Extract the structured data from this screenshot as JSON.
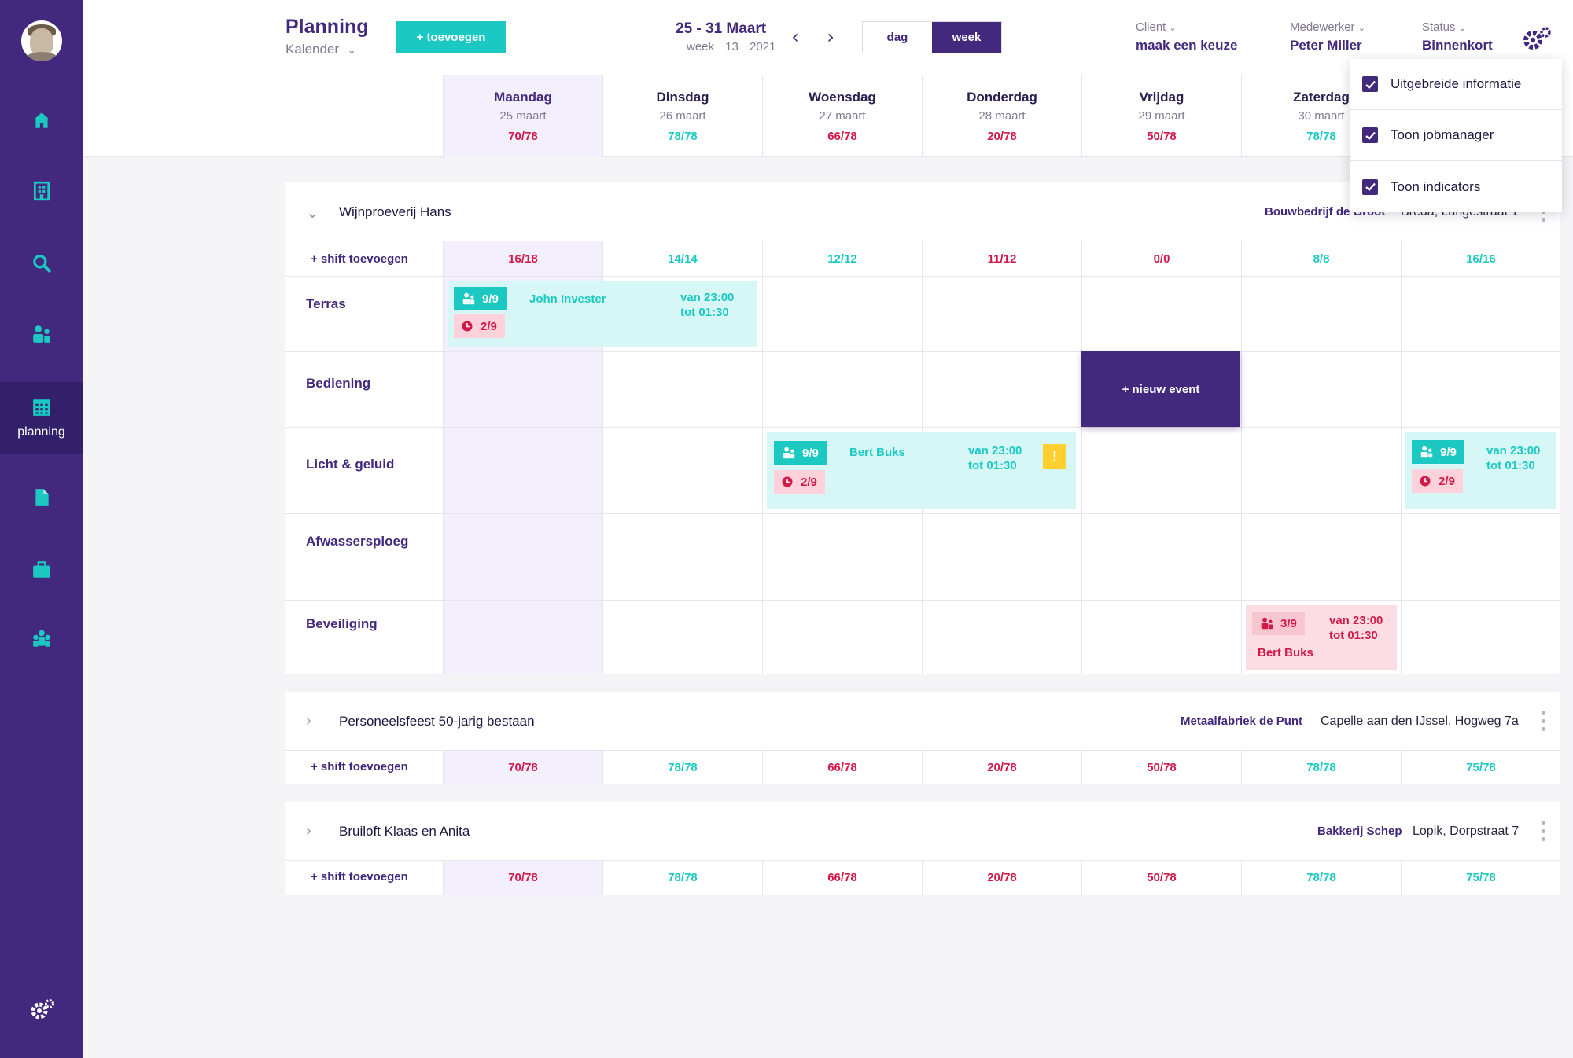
{
  "sidebar": {
    "active_label": "planning",
    "icons": [
      "home-icon",
      "building-icon",
      "search-icon",
      "people-icon",
      "calendar-icon",
      "document-icon",
      "briefcase-icon",
      "team-icon"
    ],
    "settings_icon": "gear-icon"
  },
  "header": {
    "title": "Planning",
    "view": "Kalender",
    "add_button": "+ toevoegen",
    "date_range": "25 - 31  Maart",
    "week": "week 13",
    "year": "2021",
    "toggle": {
      "day": "dag",
      "week": "week",
      "selected": "week"
    },
    "filters": [
      {
        "label": "Client",
        "value": "maak een keuze"
      },
      {
        "label": "Medewerker",
        "value": "Peter Miller"
      },
      {
        "label": "Status",
        "value": "Binnenkort"
      }
    ]
  },
  "days": [
    {
      "name": "Maandag",
      "date": "25 maart",
      "count": "70/78",
      "status": "red"
    },
    {
      "name": "Dinsdag",
      "date": "26 maart",
      "count": "78/78",
      "status": "teal"
    },
    {
      "name": "Woensdag",
      "date": "27 maart",
      "count": "66/78",
      "status": "red"
    },
    {
      "name": "Donderdag",
      "date": "28 maart",
      "count": "20/78",
      "status": "red"
    },
    {
      "name": "Vrijdag",
      "date": "29 maart",
      "count": "50/78",
      "status": "red"
    },
    {
      "name": "Zaterdag",
      "date": "30 maart",
      "count": "78/78",
      "status": "teal"
    }
  ],
  "dropdown": {
    "items": [
      {
        "label": "Uitgebreide informatie",
        "checked": true
      },
      {
        "label": "Toon jobmanager",
        "checked": true
      },
      {
        "label": "Toon indicators",
        "checked": true
      }
    ]
  },
  "events": [
    {
      "title": "Wijnproeverij Hans",
      "client": "Bouwbedrijf de Groot",
      "address": "Breda, Langestraat 1",
      "expanded": true,
      "shift_add": "+ shift toevoegen",
      "counts": [
        "16/18",
        "14/14",
        "12/12",
        "11/12",
        "0/0",
        "8/8",
        "16/16"
      ],
      "count_status": [
        "red",
        "teal",
        "teal",
        "red",
        "red",
        "teal",
        "teal"
      ],
      "rows": [
        "Terras",
        "Bediening",
        "Licht & geluid",
        "Afwassersploeg",
        "Beveiliging"
      ],
      "shifts": {
        "terras": {
          "count": "9/9",
          "late": "2/9",
          "person": "John Invester",
          "time_from": "van 23:00",
          "time_to": "tot 01:30"
        },
        "licht_wed": {
          "count": "9/9",
          "late": "2/9",
          "person": "Bert Buks",
          "time_from": "van 23:00",
          "time_to": "tot 01:30",
          "warning": "!"
        },
        "licht_sun": {
          "count": "9/9",
          "late": "2/9",
          "time_from": "van 23:00",
          "time_to": "tot 01:30"
        },
        "beveiliging": {
          "count": "3/9",
          "person": "Bert Buks",
          "time_from": "van 23:00",
          "time_to": "tot 01:30"
        }
      },
      "new_event": "+ nieuw event"
    },
    {
      "title": "Personeelsfeest 50-jarig bestaan",
      "client": "Metaalfabriek de Punt",
      "address": "Capelle aan den IJssel, Hogweg 7a",
      "expanded": false,
      "shift_add": "+ shift toevoegen",
      "counts": [
        "70/78",
        "78/78",
        "66/78",
        "20/78",
        "50/78",
        "78/78",
        "75/78"
      ],
      "count_status": [
        "red",
        "teal",
        "red",
        "red",
        "red",
        "teal",
        "teal"
      ]
    },
    {
      "title": "Bruiloft Klaas en Anita",
      "client": "Bakkerij Schep",
      "address": "Lopik, Dorpstraat 7",
      "expanded": false,
      "shift_add": "+ shift toevoegen",
      "counts": [
        "70/78",
        "78/78",
        "66/78",
        "20/78",
        "50/78",
        "78/78",
        "75/78"
      ],
      "count_status": [
        "red",
        "teal",
        "red",
        "red",
        "red",
        "teal",
        "teal"
      ]
    }
  ],
  "colors": {
    "purple": "#43297e",
    "teal": "#1cc9c2",
    "red": "#d21a49",
    "lavender": "#f3effc"
  }
}
